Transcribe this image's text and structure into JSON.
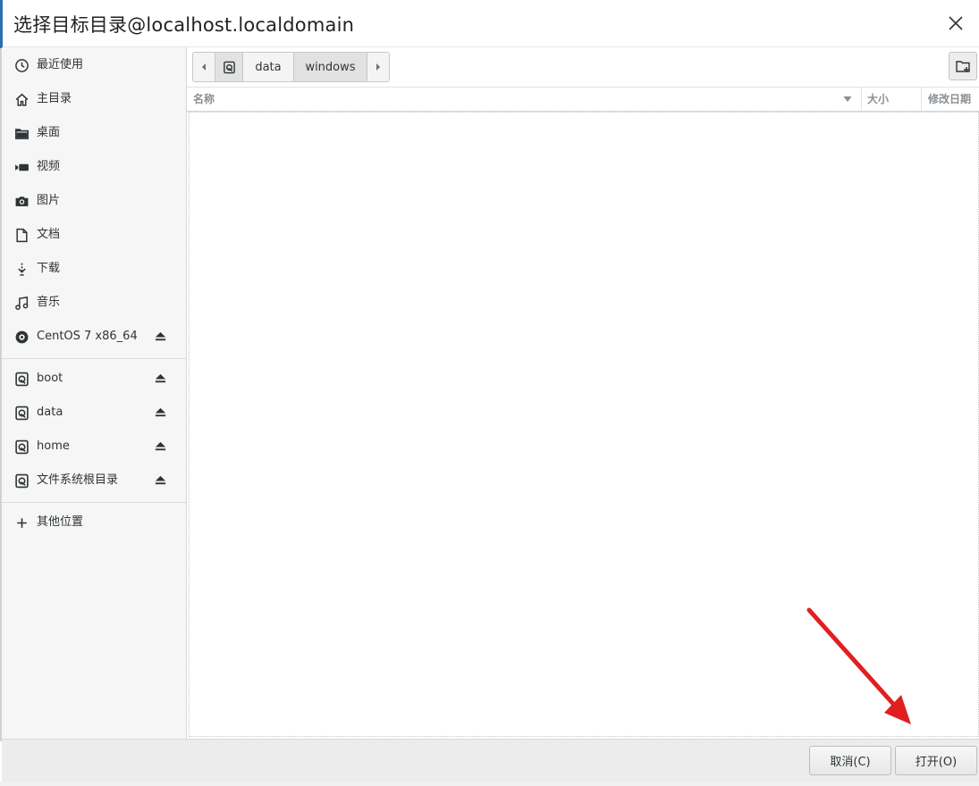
{
  "window": {
    "title": "选择目标目录@localhost.localdomain"
  },
  "sidebar": {
    "places": [
      {
        "label": "最近使用",
        "icon": "clock-icon"
      },
      {
        "label": "主目录",
        "icon": "home-icon"
      },
      {
        "label": "桌面",
        "icon": "folder-icon"
      },
      {
        "label": "视频",
        "icon": "video-icon"
      },
      {
        "label": "图片",
        "icon": "camera-icon"
      },
      {
        "label": "文档",
        "icon": "document-icon"
      },
      {
        "label": "下载",
        "icon": "download-icon"
      },
      {
        "label": "音乐",
        "icon": "music-icon"
      },
      {
        "label": "CentOS 7 x86_64",
        "icon": "disc-icon",
        "ejectable": true
      }
    ],
    "devices": [
      {
        "label": "boot",
        "icon": "drive-icon",
        "ejectable": true
      },
      {
        "label": "data",
        "icon": "drive-icon",
        "ejectable": true
      },
      {
        "label": "home",
        "icon": "drive-icon",
        "ejectable": true
      },
      {
        "label": "文件系统根目录",
        "icon": "drive-icon",
        "ejectable": true
      }
    ],
    "other_locations": {
      "label": "其他位置",
      "icon": "plus-icon"
    }
  },
  "pathbar": {
    "segments": [
      "data",
      "windows"
    ],
    "active": "windows"
  },
  "columns": {
    "name": "名称",
    "size": "大小",
    "modified": "修改日期"
  },
  "files": [],
  "buttons": {
    "cancel": "取消(C)",
    "open": "打开(O)"
  },
  "annotation": {
    "color": "#e02020",
    "points_to": "open-button"
  }
}
